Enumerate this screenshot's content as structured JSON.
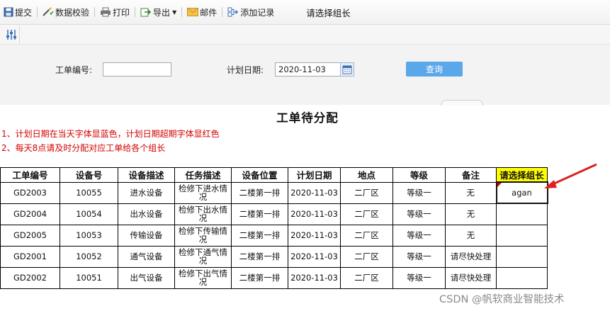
{
  "toolbar": {
    "submit": "提交",
    "validate": "数据校验",
    "print": "打印",
    "export": "导出",
    "mail": "邮件",
    "add_record": "添加记录",
    "title": "请选择组长"
  },
  "filter": {
    "order_no_label": "工单编号:",
    "order_no_value": "",
    "plan_date_label": "计划日期:",
    "plan_date_value": "2020-11-03",
    "query_label": "查询"
  },
  "report": {
    "title": "工单待分配",
    "notes": [
      "1、计划日期在当天字体显蓝色，计划日期超期字体显红色",
      "2、每天8点请及时分配对应工单给各个组长"
    ],
    "columns": [
      "工单编号",
      "设备号",
      "设备描述",
      "任务描述",
      "设备位置",
      "计划日期",
      "地点",
      "等级",
      "备注",
      "请选择组长"
    ],
    "rows": [
      {
        "order": "GD2003",
        "device": "10055",
        "desc": "进水设备",
        "task": "检修下进水情况",
        "location": "二楼第一排",
        "date": "2020-11-03",
        "site": "二厂区",
        "level": "等级一",
        "remark": "无",
        "leader": "agan"
      },
      {
        "order": "GD2004",
        "device": "10054",
        "desc": "出水设备",
        "task": "检修下出水情况",
        "location": "二楼第一排",
        "date": "2020-11-03",
        "site": "二厂区",
        "level": "等级一",
        "remark": "无",
        "leader": ""
      },
      {
        "order": "GD2005",
        "device": "10053",
        "desc": "传输设备",
        "task": "检修下传输情况",
        "location": "二楼第一排",
        "date": "2020-11-03",
        "site": "二厂区",
        "level": "等级一",
        "remark": "无",
        "leader": ""
      },
      {
        "order": "GD2001",
        "device": "10052",
        "desc": "通气设备",
        "task": "检修下通气情况",
        "location": "二楼第一排",
        "date": "2020-11-03",
        "site": "二厂区",
        "level": "等级一",
        "remark": "请尽快处理",
        "leader": ""
      },
      {
        "order": "GD2002",
        "device": "10051",
        "desc": "出气设备",
        "task": "检修下出气情况",
        "location": "二楼第一排",
        "date": "2020-11-03",
        "site": "二厂区",
        "level": "等级一",
        "remark": "请尽快处理",
        "leader": ""
      }
    ]
  },
  "watermark": "CSDN @帆软商业智能技术",
  "colors": {
    "date_blue": "#1f5fb8",
    "note_red": "#d40000",
    "header_highlight": "#ffff00",
    "query_button": "#5aa7ea"
  },
  "icons": [
    "save-icon",
    "validate-icon",
    "print-icon",
    "export-icon",
    "mail-icon",
    "add-record-icon",
    "settings-sliders-icon",
    "calendar-icon",
    "arrow-icon"
  ]
}
